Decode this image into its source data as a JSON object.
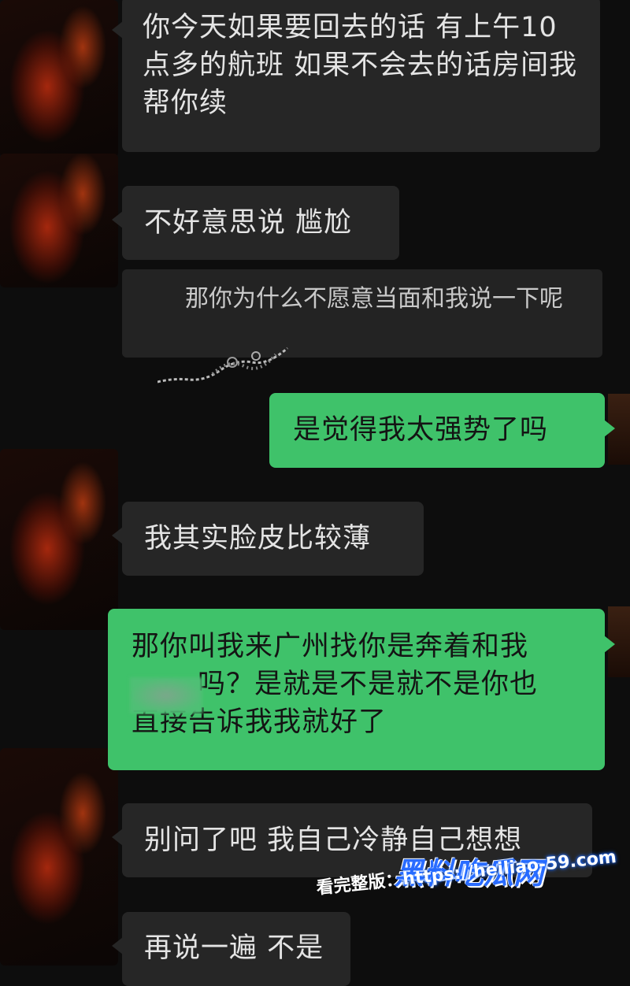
{
  "messages": [
    {
      "side": "in",
      "text": "你今天如果要回去的话 有上午10点多的航班 如果不会去的话房间我帮你续"
    },
    {
      "side": "in",
      "text": "不好意思说 尴尬"
    },
    {
      "side": "in",
      "text": "那你为什么不愿意当面和我说一下呢",
      "style": "quoted"
    },
    {
      "side": "out",
      "text": "是觉得我太强势了吗"
    },
    {
      "side": "in",
      "text": "我其实脸皮比较薄"
    },
    {
      "side": "out",
      "line1": "那你叫我来广州找你是奔着和我",
      "line2": "吗？是就是不是就不是你也",
      "line3": "直接告诉我我就好了"
    },
    {
      "side": "in",
      "text": "别问了吧 我自己冷静自己想想"
    },
    {
      "side": "in",
      "text": "再说一遍 不是"
    }
  ],
  "watermark": {
    "brand": "黑料吃瓜网",
    "label": "看完整版：",
    "url": "https://heiliao-59.com"
  },
  "colors": {
    "incoming": "#262626",
    "outgoing": "#3fc26a",
    "background": "#0d0d0d",
    "watermark": "#1e6bff"
  }
}
